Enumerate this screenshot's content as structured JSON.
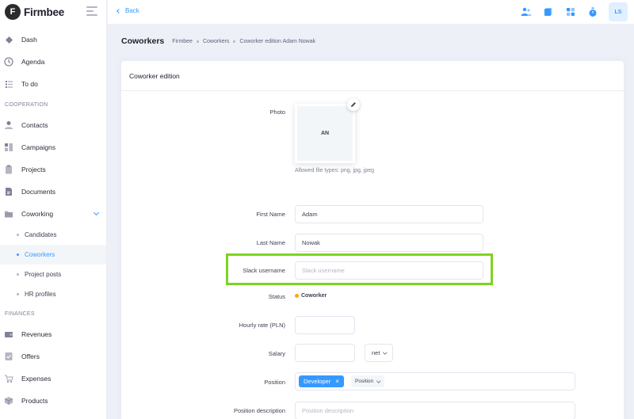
{
  "brand": {
    "name": "Firmbee",
    "logo_letter": "F"
  },
  "sidebar": {
    "main_items": [
      {
        "label": "Dash",
        "icon": "diamond-icon"
      },
      {
        "label": "Agenda",
        "icon": "clock-icon"
      },
      {
        "label": "To do",
        "icon": "list-icon"
      }
    ],
    "section_cooperation": "COOPERATION",
    "cooperation_items": [
      {
        "label": "Contacts",
        "icon": "user-icon"
      },
      {
        "label": "Campaigns",
        "icon": "campaign-icon"
      },
      {
        "label": "Projects",
        "icon": "clipboard-icon"
      },
      {
        "label": "Documents",
        "icon": "document-icon"
      },
      {
        "label": "Coworking",
        "icon": "folder-icon"
      }
    ],
    "coworking_sub": [
      {
        "label": "Candidates"
      },
      {
        "label": "Coworkers"
      },
      {
        "label": "Project posts"
      },
      {
        "label": "HR profiles"
      }
    ],
    "section_finances": "FINANCES",
    "finance_items": [
      {
        "label": "Revenues",
        "icon": "wallet-icon"
      },
      {
        "label": "Offers",
        "icon": "offer-icon"
      },
      {
        "label": "Expenses",
        "icon": "cart-icon"
      },
      {
        "label": "Products",
        "icon": "box-icon"
      }
    ]
  },
  "topbar": {
    "back_label": "Back",
    "user_initials": "LS"
  },
  "subheader": {
    "title": "Coworkers",
    "breadcrumb": [
      "Firmbee",
      "Coworkers",
      "Coworker edition Adam Nowak"
    ]
  },
  "form": {
    "card_title": "Coworker edition",
    "photo_label": "Photo",
    "photo_initials": "AN",
    "photo_hint": "Allowed file types: png, jpg, jpeg",
    "first_name_label": "First Name",
    "first_name_value": "Adam",
    "last_name_label": "Last Name",
    "last_name_value": "Nowak",
    "slack_label": "Slack username",
    "slack_placeholder": "Slack username",
    "status_label": "Status",
    "status_value": "Coworker",
    "hourly_label": "Hourly rate (PLN)",
    "hourly_value": "",
    "salary_label": "Salary",
    "salary_value": "",
    "salary_type": "net",
    "position_label": "Position",
    "position_tag": "Developer",
    "position_select": "Position",
    "position_desc_label": "Position description",
    "position_desc_placeholder": "Position description"
  },
  "colors": {
    "primary": "#3699ff",
    "highlight": "#7ed321",
    "status": "#ffa800"
  }
}
